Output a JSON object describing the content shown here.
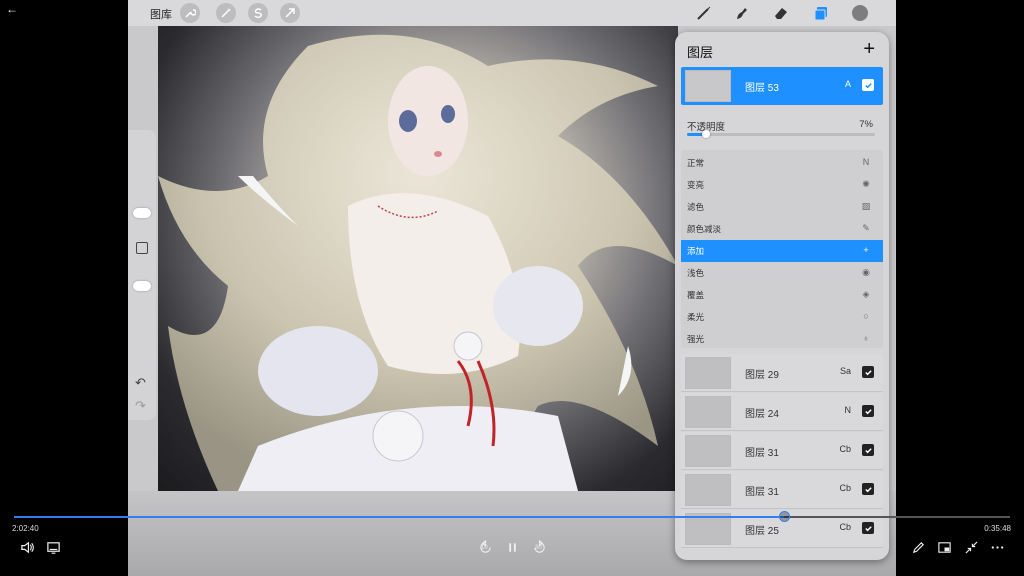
{
  "app": {
    "gallery_label": "图库",
    "tools_left": [
      "wrench-icon",
      "magic-wand-icon",
      "selection-icon",
      "transform-arrow-icon"
    ],
    "tools_right": [
      "brush-icon",
      "smudge-icon",
      "eraser-icon",
      "layers-icon",
      "color-swatch-icon"
    ],
    "accent": "#1e90ff",
    "color_swatch": "#7d7d80"
  },
  "sidebar": {
    "brush_size_level": 0.27,
    "brush_opacity_level": 0.52
  },
  "layers_panel": {
    "title": "图层",
    "add_label": "+",
    "selected_layer": {
      "name": "图层 53",
      "mode": "A",
      "visible": true
    },
    "opacity_label": "不透明度",
    "opacity_value": "7%",
    "opacity_fraction": 0.07,
    "blend_modes": [
      {
        "label": "正常",
        "icon": "N"
      },
      {
        "label": "变亮",
        "icon": "✺"
      },
      {
        "label": "滤色",
        "icon": "▨"
      },
      {
        "label": "颜色减淡",
        "icon": "✎"
      },
      {
        "label": "添加",
        "icon": "+"
      },
      {
        "label": "浅色",
        "icon": "◉"
      },
      {
        "label": "覆盖",
        "icon": "◈"
      },
      {
        "label": "柔光",
        "icon": "○"
      },
      {
        "label": "强光",
        "icon": "♁"
      }
    ],
    "active_blend": "添加",
    "layers": [
      {
        "name": "图层 29",
        "mode": "Sa"
      },
      {
        "name": "图层 24",
        "mode": "N"
      },
      {
        "name": "图层 31",
        "mode": "Cb"
      },
      {
        "name": "图层 31",
        "mode": "Cb"
      },
      {
        "name": "图层 25",
        "mode": "Cb"
      }
    ]
  },
  "player": {
    "current_time": "2:02:40",
    "total_time": "0:35:48",
    "progress_fraction": 0.773,
    "skip_back_label": "10",
    "skip_forward_label": "30"
  }
}
